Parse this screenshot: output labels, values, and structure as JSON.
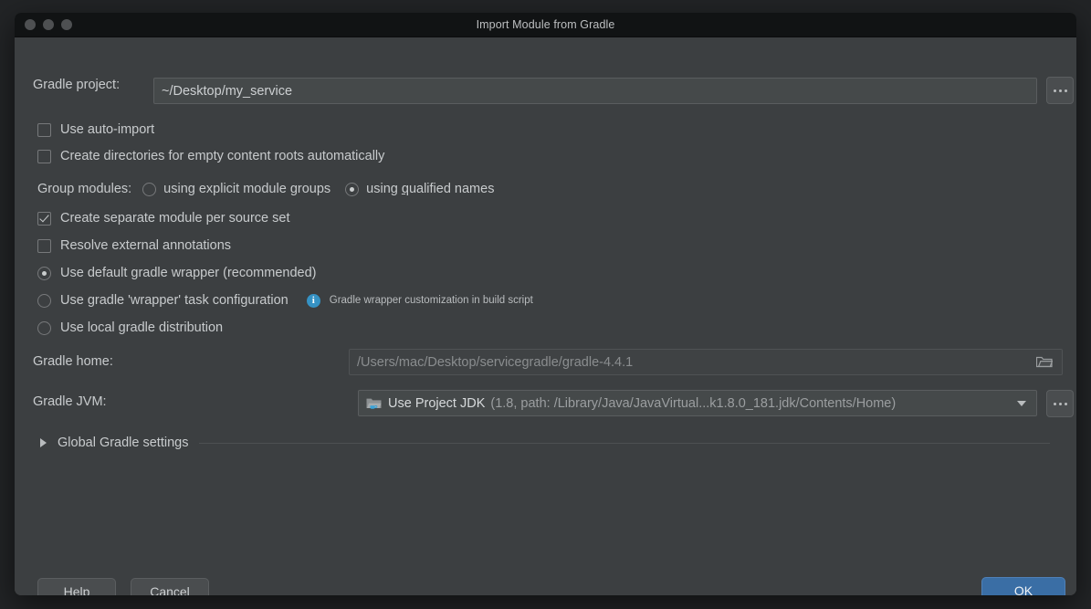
{
  "window": {
    "title": "Import Module from Gradle",
    "traffic_lights": [
      "close-light",
      "minimize-light",
      "zoom-light"
    ]
  },
  "gradle_project": {
    "label": "Gradle project:",
    "value": "~/Desktop/my_service",
    "browse_label": "...",
    "browse_icon": "ellipsis-icon"
  },
  "options": {
    "auto_import": {
      "label": "Use auto-import",
      "checked": false
    },
    "create_dirs": {
      "label": "Create directories for empty content roots automatically",
      "checked": false
    },
    "group_modules": {
      "label": "Group modules:",
      "choices": [
        {
          "label": "using explicit module groups",
          "mnemonic": "g",
          "selected": false
        },
        {
          "label": "using qualified names",
          "mnemonic": "q",
          "selected": true
        }
      ]
    },
    "separate_module": {
      "label": "Create separate module per source set",
      "checked": true
    },
    "resolve_annotations": {
      "label": "Resolve external annotations",
      "checked": false
    }
  },
  "distribution": {
    "choices": [
      {
        "label": "Use default gradle wrapper (recommended)",
        "selected": true
      },
      {
        "label": "Use gradle 'wrapper' task configuration",
        "selected": false
      },
      {
        "label": "Use local gradle distribution",
        "selected": false
      }
    ],
    "hint": {
      "icon": "info-icon",
      "text": "Gradle wrapper customization in build script",
      "color": "#3592c4"
    }
  },
  "gradle_home": {
    "label": "Gradle home:",
    "value": "/Users/mac/Desktop/servicegradle/gradle-4.4.1",
    "disabled": true,
    "folder_icon": "folder-icon"
  },
  "gradle_jvm": {
    "label": "Gradle JVM:",
    "icon": "jdk-folder-icon",
    "value_main": "Use Project JDK",
    "value_detail": "(1.8, path: /Library/Java/JavaVirtual...k1.8.0_181.jdk/Contents/Home)",
    "dropdown_icon": "chevron-down-icon",
    "browse_label": "...",
    "browse_icon": "ellipsis-icon"
  },
  "global_settings": {
    "label": "Global Gradle settings",
    "expanded": false,
    "toggle_icon": "triangle-right-icon"
  },
  "footer": {
    "help_label": "Help",
    "cancel_label": "Cancel",
    "ok_label": "OK",
    "accent": "#3a6ea5"
  }
}
